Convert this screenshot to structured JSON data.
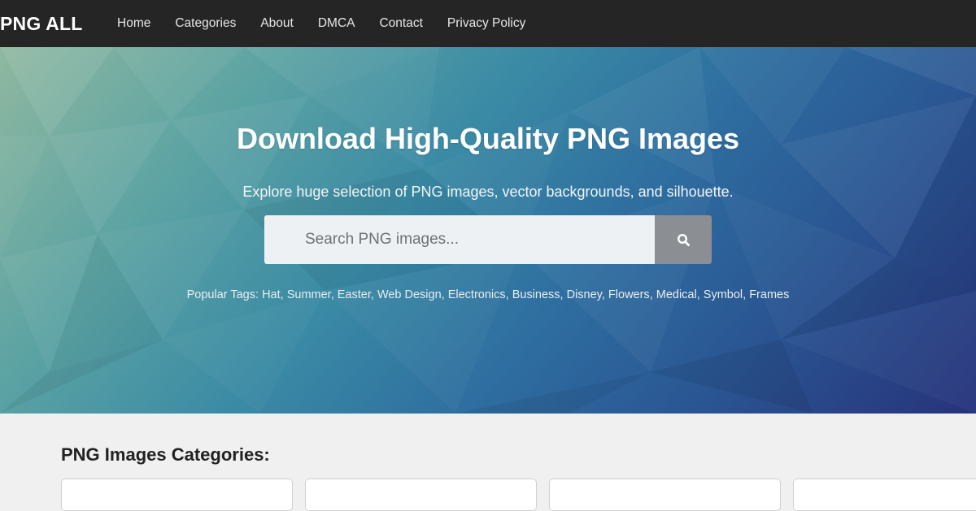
{
  "navbar": {
    "brand": "PNG ALL",
    "links": [
      "Home",
      "Categories",
      "About",
      "DMCA",
      "Contact",
      "Privacy Policy"
    ]
  },
  "hero": {
    "title": "Download High-Quality PNG Images",
    "subtitle": "Explore huge selection of PNG images, vector backgrounds, and silhouette.",
    "search": {
      "placeholder": "Search PNG images...",
      "value": "",
      "button_icon": "search-icon"
    },
    "popular_tags_label": "Popular Tags:",
    "popular_tags": [
      "Hat",
      "Summer",
      "Easter",
      "Web Design",
      "Electronics",
      "Business",
      "Disney",
      "Flowers",
      "Medical",
      "Symbol",
      "Frames"
    ]
  },
  "categories": {
    "heading": "PNG Images Categories:"
  },
  "colors": {
    "navbar_bg": "#252525",
    "page_bg": "#f0f0f0",
    "search_button": "#8b8f93"
  }
}
